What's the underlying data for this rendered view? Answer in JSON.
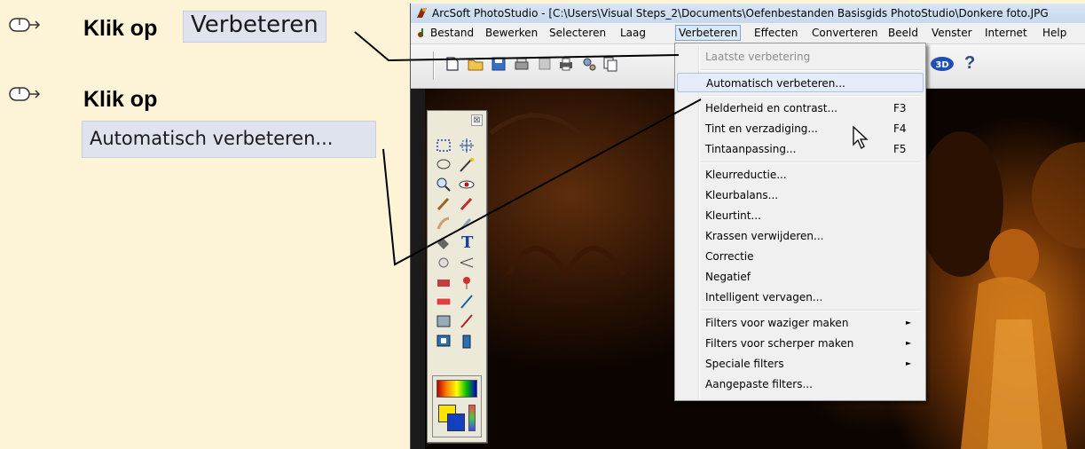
{
  "instructions": {
    "step1": {
      "icon": "mouse-click-icon",
      "text": "Klik op",
      "target": "Verbeteren"
    },
    "step2": {
      "icon": "mouse-click-icon",
      "text": "Klik op",
      "target": "Automatisch verbeteren..."
    }
  },
  "app": {
    "title": "ArcSoft PhotoStudio - [C:\\Users\\Visual Steps_2\\Documents\\Oefenbestanden Basisgids PhotoStudio\\Donkere foto.JPG",
    "menu": [
      "Bestand",
      "Bewerken",
      "Selecteren",
      "Laag",
      "Verbeteren",
      "Effecten",
      "Converteren",
      "Beeld",
      "Venster",
      "Internet",
      "Help"
    ],
    "active_menu": "Verbeteren",
    "toolbar_icons": [
      "new-icon",
      "open-icon",
      "save-icon",
      "scan-icon",
      "print-preview-icon",
      "print-icon",
      "settings-icon",
      "copy-icon",
      "3d-icon",
      "help-icon"
    ],
    "toolbar_3d_label": "3D",
    "toolbar_help_label": "?",
    "palette_close": "⊠",
    "palette_text_tool": "T",
    "dropdown": {
      "items": [
        {
          "label": "Laatste verbetering",
          "shortcut": "",
          "submenu": false,
          "disabled": true
        },
        {
          "label": "Automatisch verbeteren...",
          "shortcut": "",
          "submenu": false,
          "disabled": false,
          "hovered": true
        },
        {
          "label": "Helderheid en contrast...",
          "shortcut": "F3",
          "submenu": false,
          "disabled": false
        },
        {
          "label": "Tint en verzadiging...",
          "shortcut": "F4",
          "submenu": false,
          "disabled": false
        },
        {
          "label": "Tintaanpassing...",
          "shortcut": "F5",
          "submenu": false,
          "disabled": false
        },
        {
          "label": "Kleurreductie...",
          "shortcut": "",
          "submenu": false,
          "disabled": false
        },
        {
          "label": "Kleurbalans...",
          "shortcut": "",
          "submenu": false,
          "disabled": false
        },
        {
          "label": "Kleurtint...",
          "shortcut": "",
          "submenu": false,
          "disabled": false
        },
        {
          "label": "Krassen verwijderen...",
          "shortcut": "",
          "submenu": false,
          "disabled": false
        },
        {
          "label": "Correctie",
          "shortcut": "",
          "submenu": false,
          "disabled": false
        },
        {
          "label": "Negatief",
          "shortcut": "",
          "submenu": false,
          "disabled": false
        },
        {
          "label": "Intelligent vervagen...",
          "shortcut": "",
          "submenu": false,
          "disabled": false
        },
        {
          "label": "Filters voor waziger maken",
          "shortcut": "",
          "submenu": true,
          "disabled": false
        },
        {
          "label": "Filters voor scherper maken",
          "shortcut": "",
          "submenu": true,
          "disabled": false
        },
        {
          "label": "Speciale filters",
          "shortcut": "",
          "submenu": true,
          "disabled": false
        },
        {
          "label": "Aangepaste filters...",
          "shortcut": "",
          "submenu": false,
          "disabled": false
        }
      ],
      "submenu_arrow": "►"
    }
  },
  "colors": {
    "panel_bg": "#fdf3d6",
    "highlight_bg": "#dfe3ee",
    "menu_active_border": "#7ea4d4"
  }
}
